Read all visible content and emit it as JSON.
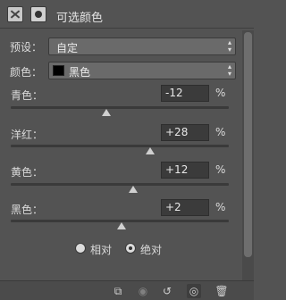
{
  "header": {
    "title": "可选颜色"
  },
  "preset": {
    "label": "预设：",
    "value": "自定"
  },
  "colors": {
    "label": "颜色：",
    "value": "黑色",
    "swatch": "#000000"
  },
  "sliders": [
    {
      "label": "青色：",
      "value": "-12",
      "unit": "%",
      "level": -0.12
    },
    {
      "label": "洋红：",
      "value": "+28",
      "unit": "%",
      "level": 0.28
    },
    {
      "label": "黄色：",
      "value": "+12",
      "unit": "%",
      "level": 0.12
    },
    {
      "label": "黑色：",
      "value": "+2",
      "unit": "%",
      "level": 0.02
    }
  ],
  "method": {
    "options": [
      {
        "label": "相对",
        "selected": false
      },
      {
        "label": "绝对",
        "selected": true
      }
    ]
  },
  "footer": {
    "icons": [
      "clip-to-layer-icon",
      "view-previous-icon",
      "reset-icon",
      "visibility-eye-icon",
      "trash-icon"
    ]
  }
}
